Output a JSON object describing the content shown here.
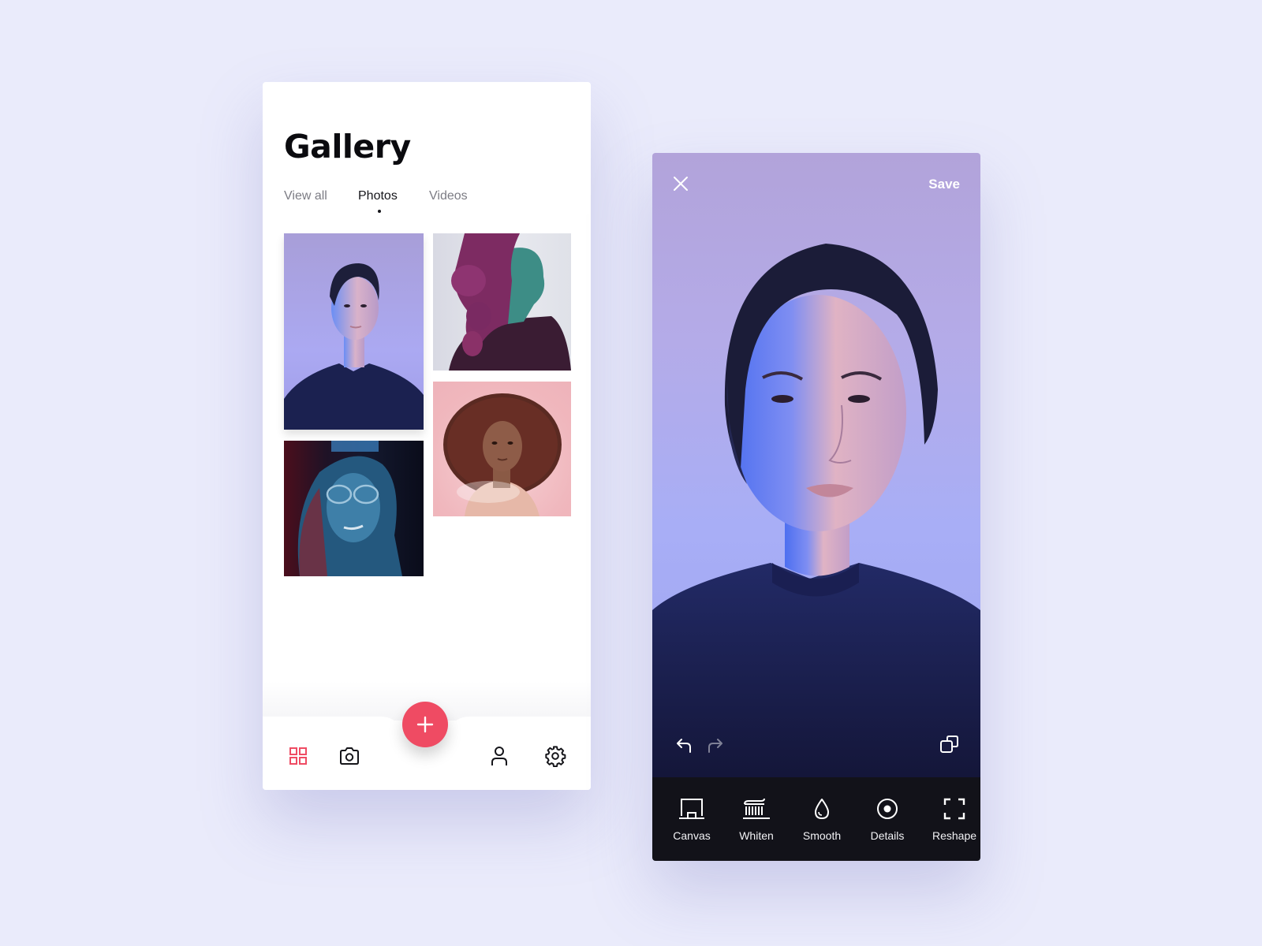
{
  "gallery": {
    "title": "Gallery",
    "tabs": [
      {
        "label": "View all",
        "active": false
      },
      {
        "label": "Photos",
        "active": true
      },
      {
        "label": "Videos",
        "active": false
      }
    ],
    "photos": [
      {
        "description": "Woman portrait, purple backdrop, dark sweater"
      },
      {
        "description": "Woman profile with braided hair, magenta and teal light"
      },
      {
        "description": "Girl with curly hair on pink backdrop"
      },
      {
        "description": "Woman with glasses in red and blue light"
      }
    ],
    "bottom_nav": {
      "items": [
        {
          "icon": "grid-icon",
          "active": true
        },
        {
          "icon": "camera-icon",
          "active": false
        },
        {
          "icon": "user-icon",
          "active": false
        },
        {
          "icon": "settings-icon",
          "active": false
        }
      ],
      "fab_icon": "plus-icon"
    },
    "colors": {
      "accent": "#ef4b63",
      "text": "#0b0b0f",
      "muted": "#7c7c84"
    }
  },
  "editor": {
    "close_icon": "close-icon",
    "save_label": "Save",
    "undo_icon": "undo-icon",
    "redo_icon": "redo-icon",
    "compare_icon": "compare-icon",
    "tools": [
      {
        "label": "Canvas",
        "icon": "canvas-icon"
      },
      {
        "label": "Whiten",
        "icon": "toothbrush-icon"
      },
      {
        "label": "Smooth",
        "icon": "drop-icon"
      },
      {
        "label": "Details",
        "icon": "target-icon"
      },
      {
        "label": "Reshape",
        "icon": "reshape-icon"
      }
    ],
    "colors": {
      "toolbar_bg": "#121219",
      "text": "#ffffff"
    }
  }
}
